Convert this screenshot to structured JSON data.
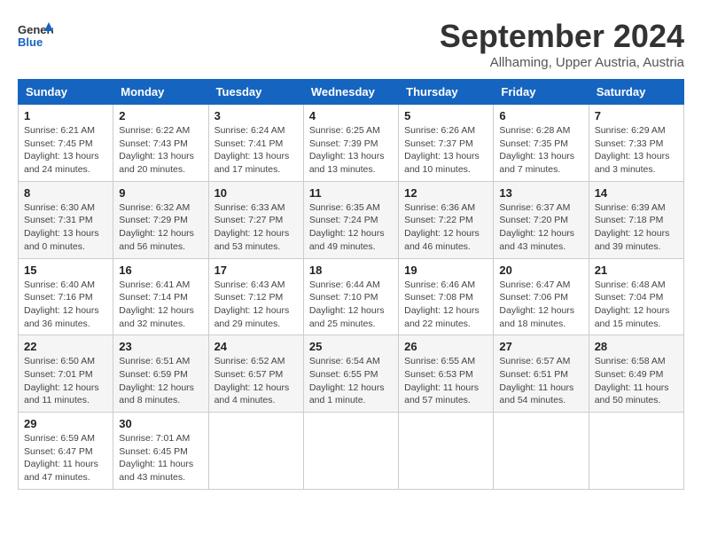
{
  "logo": {
    "line1": "General",
    "line2": "Blue"
  },
  "title": "September 2024",
  "subtitle": "Allhaming, Upper Austria, Austria",
  "weekdays": [
    "Sunday",
    "Monday",
    "Tuesday",
    "Wednesday",
    "Thursday",
    "Friday",
    "Saturday"
  ],
  "weeks": [
    [
      {
        "day": "1",
        "info": "Sunrise: 6:21 AM\nSunset: 7:45 PM\nDaylight: 13 hours\nand 24 minutes."
      },
      {
        "day": "2",
        "info": "Sunrise: 6:22 AM\nSunset: 7:43 PM\nDaylight: 13 hours\nand 20 minutes."
      },
      {
        "day": "3",
        "info": "Sunrise: 6:24 AM\nSunset: 7:41 PM\nDaylight: 13 hours\nand 17 minutes."
      },
      {
        "day": "4",
        "info": "Sunrise: 6:25 AM\nSunset: 7:39 PM\nDaylight: 13 hours\nand 13 minutes."
      },
      {
        "day": "5",
        "info": "Sunrise: 6:26 AM\nSunset: 7:37 PM\nDaylight: 13 hours\nand 10 minutes."
      },
      {
        "day": "6",
        "info": "Sunrise: 6:28 AM\nSunset: 7:35 PM\nDaylight: 13 hours\nand 7 minutes."
      },
      {
        "day": "7",
        "info": "Sunrise: 6:29 AM\nSunset: 7:33 PM\nDaylight: 13 hours\nand 3 minutes."
      }
    ],
    [
      {
        "day": "8",
        "info": "Sunrise: 6:30 AM\nSunset: 7:31 PM\nDaylight: 13 hours\nand 0 minutes."
      },
      {
        "day": "9",
        "info": "Sunrise: 6:32 AM\nSunset: 7:29 PM\nDaylight: 12 hours\nand 56 minutes."
      },
      {
        "day": "10",
        "info": "Sunrise: 6:33 AM\nSunset: 7:27 PM\nDaylight: 12 hours\nand 53 minutes."
      },
      {
        "day": "11",
        "info": "Sunrise: 6:35 AM\nSunset: 7:24 PM\nDaylight: 12 hours\nand 49 minutes."
      },
      {
        "day": "12",
        "info": "Sunrise: 6:36 AM\nSunset: 7:22 PM\nDaylight: 12 hours\nand 46 minutes."
      },
      {
        "day": "13",
        "info": "Sunrise: 6:37 AM\nSunset: 7:20 PM\nDaylight: 12 hours\nand 43 minutes."
      },
      {
        "day": "14",
        "info": "Sunrise: 6:39 AM\nSunset: 7:18 PM\nDaylight: 12 hours\nand 39 minutes."
      }
    ],
    [
      {
        "day": "15",
        "info": "Sunrise: 6:40 AM\nSunset: 7:16 PM\nDaylight: 12 hours\nand 36 minutes."
      },
      {
        "day": "16",
        "info": "Sunrise: 6:41 AM\nSunset: 7:14 PM\nDaylight: 12 hours\nand 32 minutes."
      },
      {
        "day": "17",
        "info": "Sunrise: 6:43 AM\nSunset: 7:12 PM\nDaylight: 12 hours\nand 29 minutes."
      },
      {
        "day": "18",
        "info": "Sunrise: 6:44 AM\nSunset: 7:10 PM\nDaylight: 12 hours\nand 25 minutes."
      },
      {
        "day": "19",
        "info": "Sunrise: 6:46 AM\nSunset: 7:08 PM\nDaylight: 12 hours\nand 22 minutes."
      },
      {
        "day": "20",
        "info": "Sunrise: 6:47 AM\nSunset: 7:06 PM\nDaylight: 12 hours\nand 18 minutes."
      },
      {
        "day": "21",
        "info": "Sunrise: 6:48 AM\nSunset: 7:04 PM\nDaylight: 12 hours\nand 15 minutes."
      }
    ],
    [
      {
        "day": "22",
        "info": "Sunrise: 6:50 AM\nSunset: 7:01 PM\nDaylight: 12 hours\nand 11 minutes."
      },
      {
        "day": "23",
        "info": "Sunrise: 6:51 AM\nSunset: 6:59 PM\nDaylight: 12 hours\nand 8 minutes."
      },
      {
        "day": "24",
        "info": "Sunrise: 6:52 AM\nSunset: 6:57 PM\nDaylight: 12 hours\nand 4 minutes."
      },
      {
        "day": "25",
        "info": "Sunrise: 6:54 AM\nSunset: 6:55 PM\nDaylight: 12 hours\nand 1 minute."
      },
      {
        "day": "26",
        "info": "Sunrise: 6:55 AM\nSunset: 6:53 PM\nDaylight: 11 hours\nand 57 minutes."
      },
      {
        "day": "27",
        "info": "Sunrise: 6:57 AM\nSunset: 6:51 PM\nDaylight: 11 hours\nand 54 minutes."
      },
      {
        "day": "28",
        "info": "Sunrise: 6:58 AM\nSunset: 6:49 PM\nDaylight: 11 hours\nand 50 minutes."
      }
    ],
    [
      {
        "day": "29",
        "info": "Sunrise: 6:59 AM\nSunset: 6:47 PM\nDaylight: 11 hours\nand 47 minutes."
      },
      {
        "day": "30",
        "info": "Sunrise: 7:01 AM\nSunset: 6:45 PM\nDaylight: 11 hours\nand 43 minutes."
      },
      null,
      null,
      null,
      null,
      null
    ]
  ]
}
